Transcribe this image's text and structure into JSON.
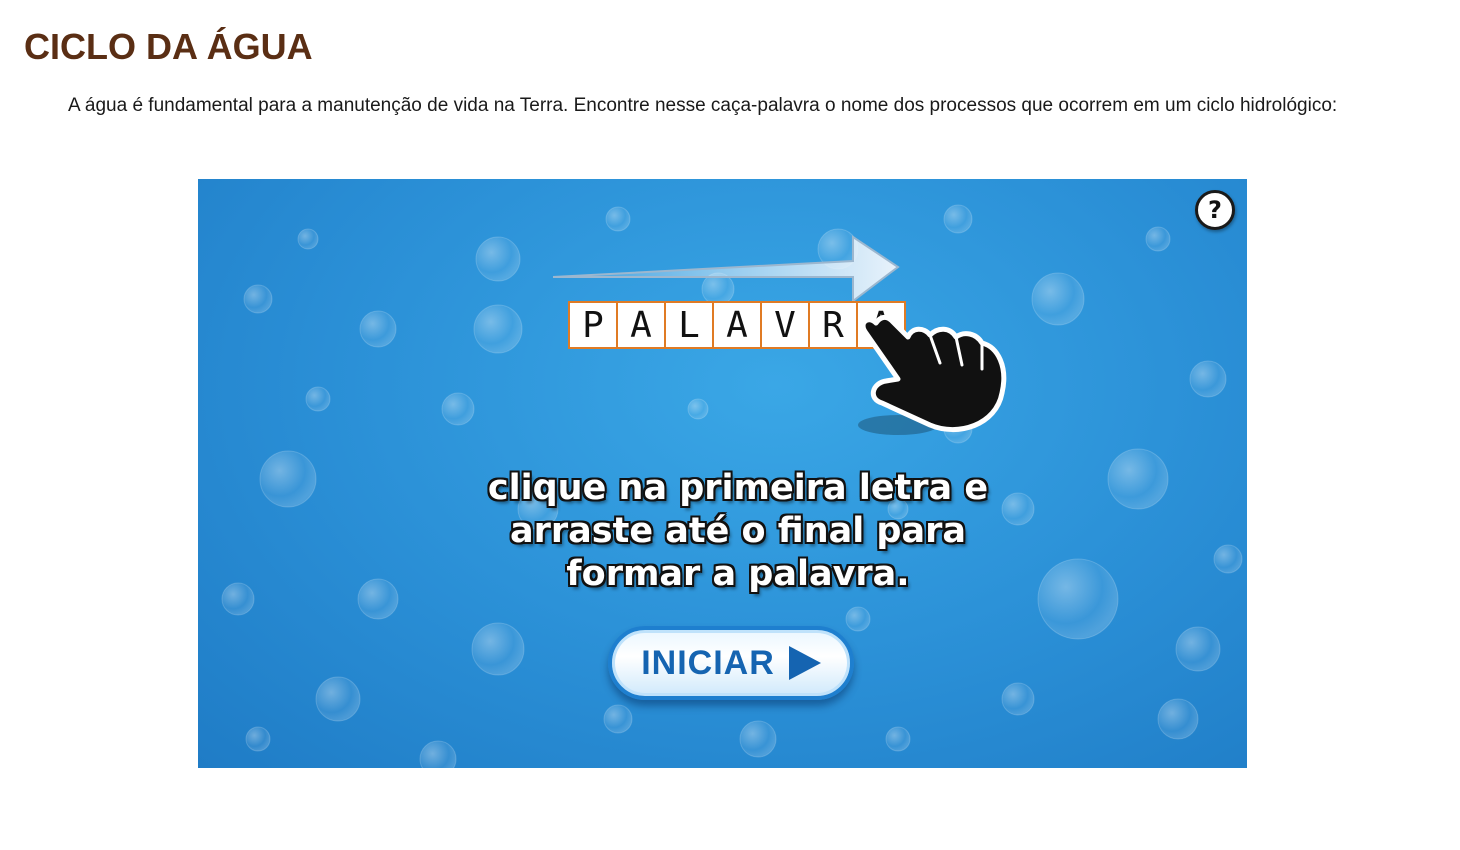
{
  "header": {
    "title": "CICLO DA ÁGUA",
    "intro": "A água é fundamental para a manutenção de vida na Terra. Encontre nesse caça-palavra o nome dos processos que ocorrem em um ciclo hidrológico:"
  },
  "game": {
    "help_label": "?",
    "example_letters": [
      "P",
      "A",
      "L",
      "A",
      "V",
      "R",
      "A"
    ],
    "instruction_lines": [
      "clique na primeira letra e",
      "arraste até o final para",
      "formar a palavra."
    ],
    "start_label": "INICIAR",
    "colors": {
      "background": "#2a8fd6",
      "title": "#5a2e14",
      "letter_border": "#e07b24",
      "button_text": "#1564b1"
    },
    "icons": [
      "help-icon",
      "arrow-right-icon",
      "pointing-hand-icon",
      "play-icon"
    ]
  }
}
